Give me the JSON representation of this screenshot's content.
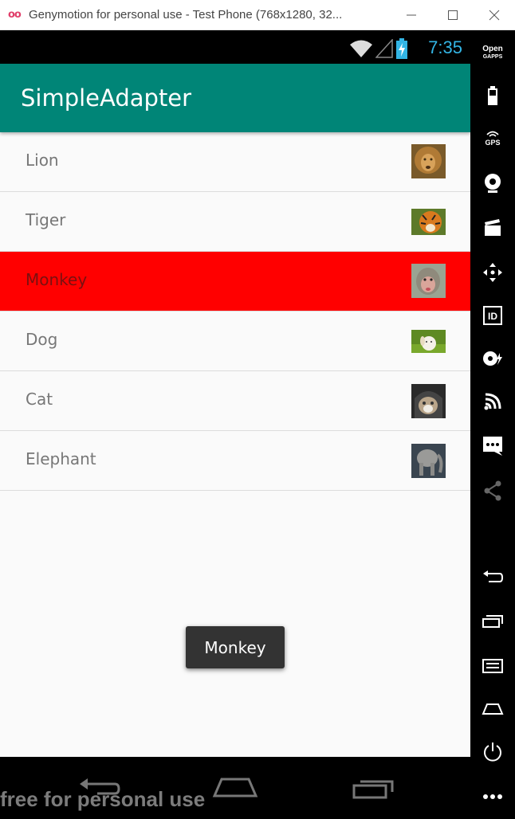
{
  "window": {
    "title": "Genymotion for personal use - Test Phone (768x1280, 32...",
    "logo": "oo",
    "controls": [
      "minimize-icon",
      "maximize-icon",
      "close-icon"
    ]
  },
  "statusbar": {
    "time": "7:35",
    "icons": [
      "wifi-icon",
      "signal-icon",
      "battery-charging-icon"
    ],
    "colors": {
      "time": "#33b5e5"
    }
  },
  "toolbar": {
    "title": "SimpleAdapter",
    "color": "#008577"
  },
  "list": {
    "items": [
      {
        "label": "Lion",
        "image": "lion-photo",
        "selected": false
      },
      {
        "label": "Tiger",
        "image": "tiger-photo",
        "selected": false
      },
      {
        "label": "Monkey",
        "image": "monkey-photo",
        "selected": true
      },
      {
        "label": "Dog",
        "image": "dog-photo",
        "selected": false
      },
      {
        "label": "Cat",
        "image": "cat-photo",
        "selected": false
      },
      {
        "label": "Elephant",
        "image": "elephant-photo",
        "selected": false
      }
    ],
    "selected_color": "#ff0000"
  },
  "toast": {
    "text": "Monkey"
  },
  "navbar": {
    "buttons": [
      "back-icon",
      "home-icon",
      "recents-icon"
    ]
  },
  "watermark": {
    "text": "free for personal use"
  },
  "sidepanel": {
    "gapps": {
      "line1": "Open",
      "line2": "GAPPS"
    },
    "gps_label": "GPS",
    "id_label": "ID",
    "buttons": [
      "open-gapps-icon",
      "battery-icon",
      "gps-icon",
      "webcam-icon",
      "screencast-icon",
      "dpad-icon",
      "device-id-icon",
      "disk-io-icon",
      "network-icon",
      "sms-icon",
      "share-icon",
      "back-icon",
      "recent-apps-icon",
      "menu-icon",
      "home-icon",
      "power-icon",
      "more-icon"
    ]
  }
}
